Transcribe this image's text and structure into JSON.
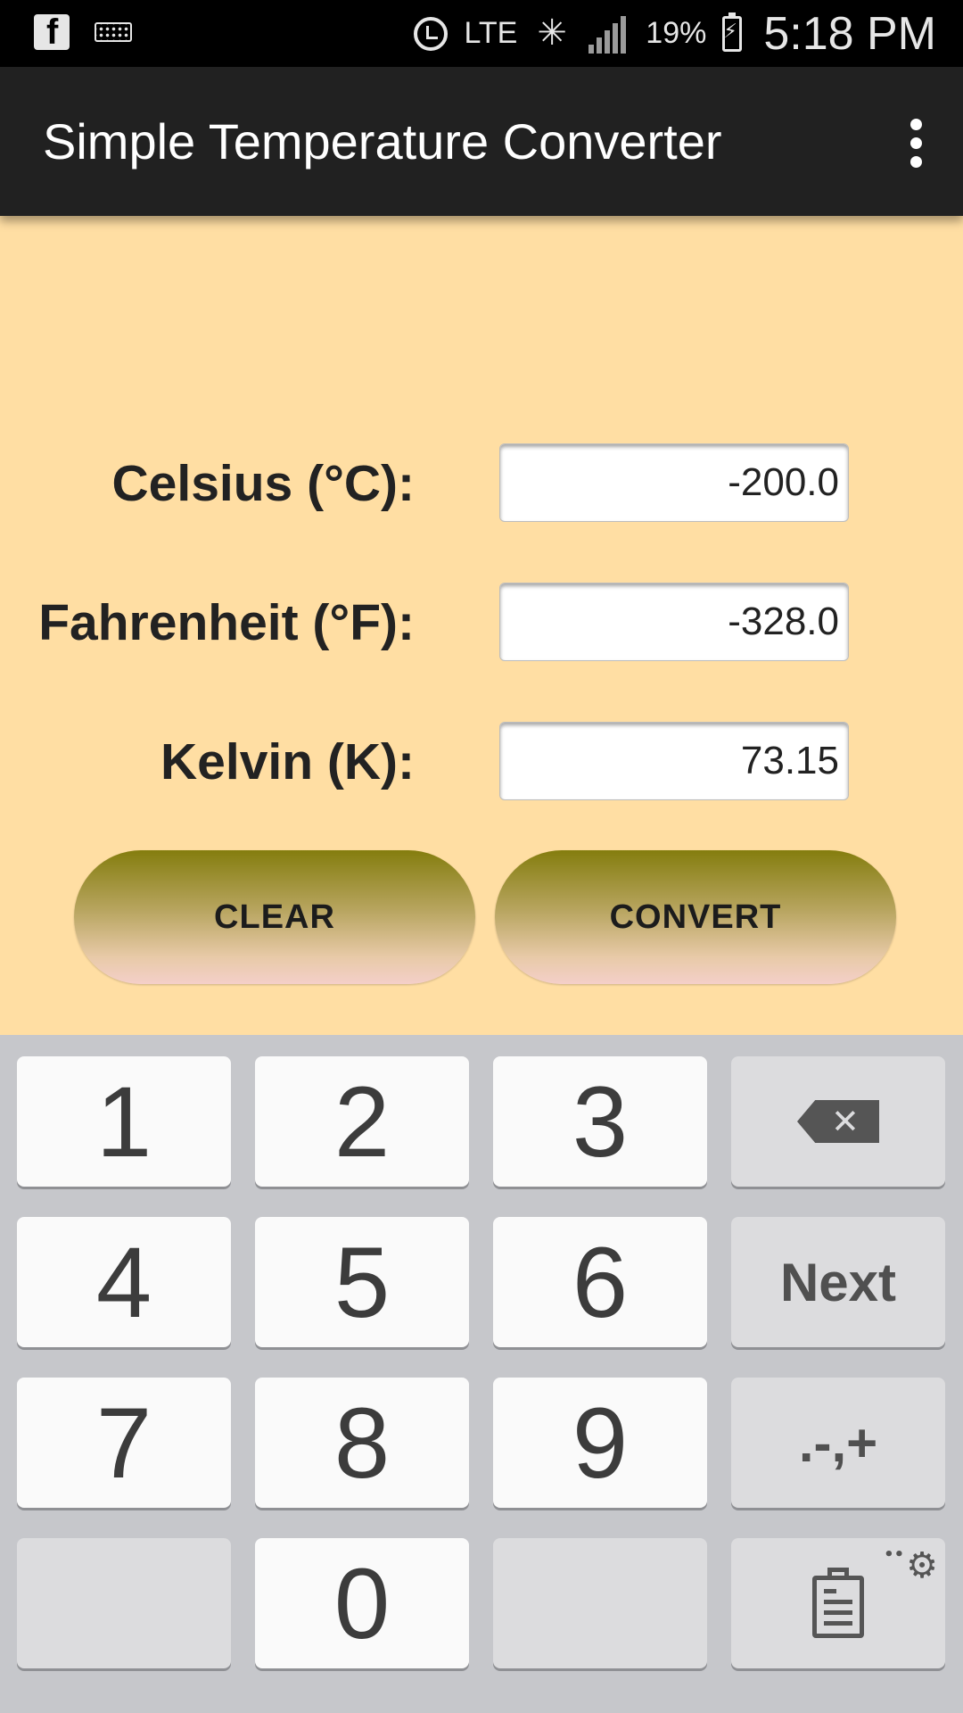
{
  "status_bar": {
    "network": "LTE",
    "battery": "19%",
    "time": "5:18 PM",
    "icons": [
      "facebook-icon",
      "keyboard-icon",
      "alarm-icon",
      "network-activity-icon",
      "signal-icon",
      "battery-charging-icon"
    ]
  },
  "app_bar": {
    "title": "Simple Temperature Converter",
    "overflow_icon": "more-vert-icon"
  },
  "form": {
    "celsius": {
      "label": "Celsius (°C):",
      "value": "-200.0"
    },
    "fahrenheit": {
      "label": "Fahrenheit (°F):",
      "value": "-328.0"
    },
    "kelvin": {
      "label": "Kelvin (K):",
      "value": "73.15"
    },
    "clear_label": "CLEAR",
    "convert_label": "CONVERT"
  },
  "keyboard": {
    "keys": [
      "1",
      "2",
      "3",
      "4",
      "5",
      "6",
      "7",
      "8",
      "9",
      "0"
    ],
    "next_label": "Next",
    "symbols_label": ".-,+",
    "backspace_icon": "backspace-icon",
    "clipboard_icon": "clipboard-icon",
    "settings_icon": "settings-icon"
  },
  "colors": {
    "background": "#ffdea3",
    "app_bar": "#212121",
    "button_top": "#847d0e",
    "button_bottom": "#f4cfc9",
    "keyboard": "#c6c7cb"
  }
}
